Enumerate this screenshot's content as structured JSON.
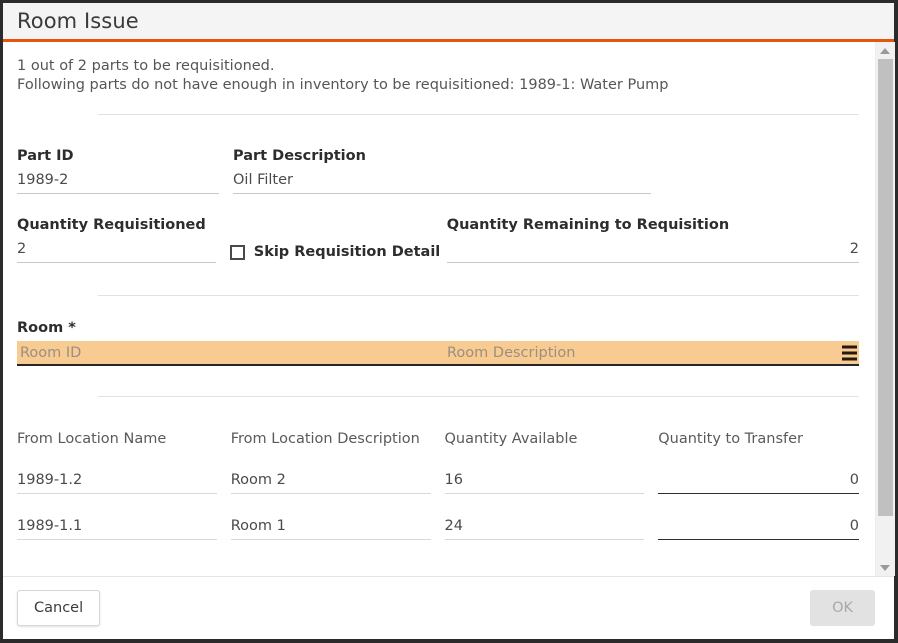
{
  "window": {
    "title": "Room Issue",
    "accent_color": "#e8540c",
    "highlight_color": "#f8cb93"
  },
  "messages": {
    "line1": "1 out of 2 parts to be requisitioned.",
    "line2": "Following parts do not have enough in inventory to be requisitioned: 1989-1: Water Pump"
  },
  "part": {
    "id_label": "Part ID",
    "id_value": "1989-2",
    "description_label": "Part Description",
    "description_value": "Oil Filter"
  },
  "quantity": {
    "requisitioned_label": "Quantity Requisitioned",
    "requisitioned_value": "2",
    "remaining_label": "Quantity Remaining to Requisition",
    "remaining_value": "2",
    "skip_checkbox_label": "Skip Requisition Detail",
    "skip_checkbox_checked": false
  },
  "room": {
    "label": "Room *",
    "id_placeholder": "Room ID",
    "description_placeholder": "Room Description",
    "lookup_icon": "list-lookup-icon"
  },
  "locations": {
    "columns": [
      "From Location Name",
      "From Location Description",
      "Quantity Available",
      "Quantity to Transfer"
    ],
    "rows": [
      {
        "from_location_name": "1989-1.2",
        "from_location_description": "Room 2",
        "quantity_available": "16",
        "quantity_to_transfer": "0"
      },
      {
        "from_location_name": "1989-1.1",
        "from_location_description": "Room 1",
        "quantity_available": "24",
        "quantity_to_transfer": "0"
      }
    ]
  },
  "footer": {
    "cancel_label": "Cancel",
    "ok_label": "OK",
    "ok_disabled": true
  },
  "scrollbar": {
    "up_icon": "chevron-up-icon",
    "down_icon": "chevron-down-icon"
  }
}
